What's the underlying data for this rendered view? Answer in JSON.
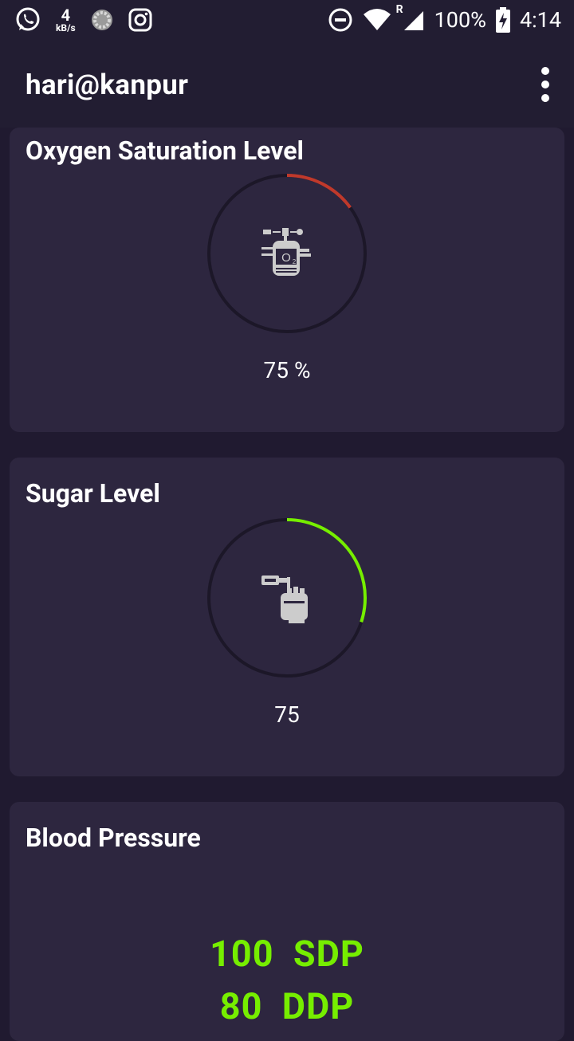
{
  "status_bar": {
    "net_speed_value": "4",
    "net_speed_unit": "kB/s",
    "signal_roaming_mark": "R",
    "battery": "100%",
    "time": "4:14",
    "icons": [
      "whatsapp-icon",
      "speed-icon",
      "loading-icon",
      "instagram-icon",
      "do-not-disturb-icon",
      "wifi-icon",
      "signal-icon",
      "battery-charging-icon"
    ]
  },
  "app_bar": {
    "title": "hari@kanpur"
  },
  "oxygen": {
    "title": "Oxygen Saturation Level",
    "value_text": "75 %",
    "arc_fraction": 0.15,
    "arc_color": "#c0392b",
    "icon": "oxygen-tank-icon"
  },
  "sugar": {
    "title": "Sugar Level",
    "value_text": "75",
    "arc_fraction": 0.3,
    "arc_color": "#76ee00",
    "icon": "glucose-test-icon"
  },
  "blood_pressure": {
    "title": "Blood Pressure",
    "systolic": "100  SDP",
    "diastolic": "80  DDP",
    "color": "#76ee00"
  }
}
